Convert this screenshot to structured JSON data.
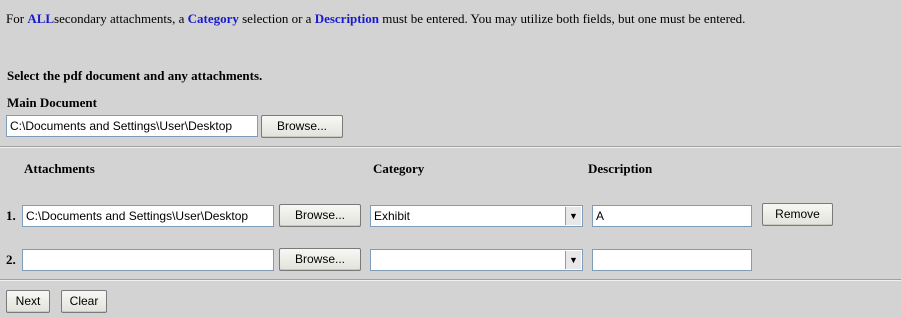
{
  "instructions": {
    "prefix": "For ",
    "all_keyword": "ALL",
    "mid1": "secondary attachments, a ",
    "category_keyword": "Category",
    "mid2": " selection or a ",
    "description_keyword": "Description",
    "suffix": " must be entered. You may utilize both fields, but one must be entered."
  },
  "select_heading": "Select the pdf document and any attachments.",
  "main_document": {
    "label": "Main Document",
    "path_value": "C:\\Documents and Settings\\User\\Desktop",
    "browse_label": "Browse..."
  },
  "columns": {
    "attachments": "Attachments",
    "category": "Category",
    "description": "Description"
  },
  "rows": [
    {
      "number": "1.",
      "path_value": "C:\\Documents and Settings\\User\\Desktop",
      "browse_label": "Browse...",
      "category_value": "Exhibit",
      "description_value": "A",
      "remove_label": "Remove"
    },
    {
      "number": "2.",
      "path_value": "",
      "browse_label": "Browse...",
      "category_value": "",
      "description_value": ""
    }
  ],
  "footer": {
    "next_label": "Next",
    "clear_label": "Clear"
  },
  "icons": {
    "dropdown": "chevron-down-icon"
  }
}
